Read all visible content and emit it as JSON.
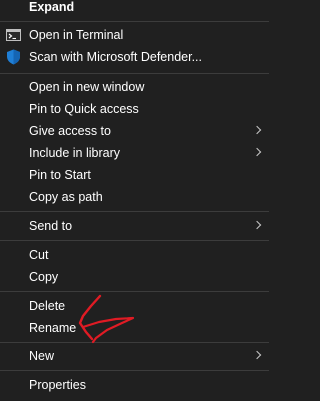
{
  "menu": {
    "expand": "Expand",
    "open_terminal": "Open in Terminal",
    "scan_defender": "Scan with Microsoft Defender...",
    "open_new_window": "Open in new window",
    "pin_quick_access": "Pin to Quick access",
    "give_access": "Give access to",
    "include_library": "Include in library",
    "pin_start": "Pin to Start",
    "copy_path": "Copy as path",
    "send_to": "Send to",
    "cut": "Cut",
    "copy": "Copy",
    "delete": "Delete",
    "rename": "Rename",
    "new": "New",
    "properties": "Properties"
  },
  "icons": {
    "terminal": "terminal-icon",
    "defender": "defender-shield-icon",
    "submenu": "chevron-right-icon"
  },
  "colors": {
    "background": "#202020",
    "text": "#ffffff",
    "separator": "#3c3c3c",
    "annotation": "#e01b24",
    "shield": "#1f7fd6"
  }
}
